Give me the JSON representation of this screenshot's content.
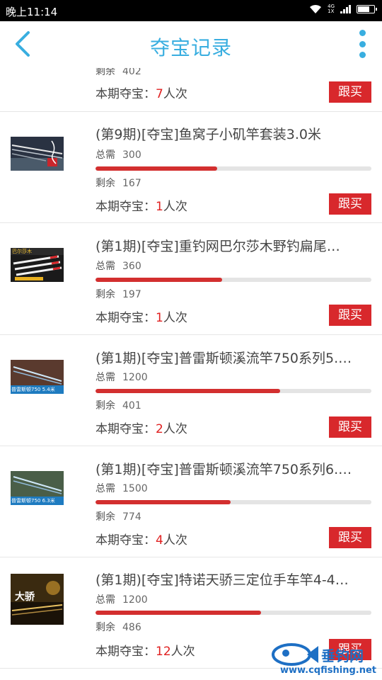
{
  "status_bar": {
    "time": "晚上11:14",
    "network": "4G\n1X"
  },
  "header": {
    "title": "夺宝记录"
  },
  "labels": {
    "total": "总需",
    "remaining": "剩余",
    "period_prefix": "本期夺宝：",
    "period_suffix": "人次",
    "buy": "跟买"
  },
  "top_partial": {
    "remaining": "402",
    "count": "7"
  },
  "items": [
    {
      "title": "(第9期)[夺宝]鱼窝子小矶竿套装3.0米",
      "total": "300",
      "remaining": "167",
      "progress": 0.44,
      "count": "1",
      "thumb": "fishing-rod-thumb"
    },
    {
      "title": "(第1期)[夺宝]重钓网巴尔莎木野钓扁尾…",
      "total": "360",
      "remaining": "197",
      "progress": 0.46,
      "count": "1",
      "thumb": "fishing-float-thumb"
    },
    {
      "title": "(第1期)[夺宝]普雷斯顿溪流竿750系列5.…",
      "total": "1200",
      "remaining": "401",
      "progress": 0.67,
      "count": "2",
      "thumb": "stream-rod-thumb"
    },
    {
      "title": "(第1期)[夺宝]普雷斯顿溪流竿750系列6.…",
      "total": "1500",
      "remaining": "774",
      "progress": 0.49,
      "count": "4",
      "thumb": "stream-rod-thumb"
    },
    {
      "title": "(第1期)[夺宝]特诺天骄三定位手车竿4-4…",
      "total": "1200",
      "remaining": "486",
      "progress": 0.6,
      "count": "12",
      "thumb": "hand-rod-thumb"
    }
  ],
  "thumb_text": {
    "item2_brand": "巴尔莎木",
    "item3_caption": "普雷斯顿750 5.4米",
    "item4_caption": "普雷斯顿750 6.3米",
    "item5_caption": "大骄"
  },
  "watermark": {
    "brand": "垂钓网",
    "url": "www.cqfishing.net"
  },
  "colors": {
    "accent": "#39aee0",
    "buy": "#d8282c",
    "progress": "#d32f2f"
  }
}
